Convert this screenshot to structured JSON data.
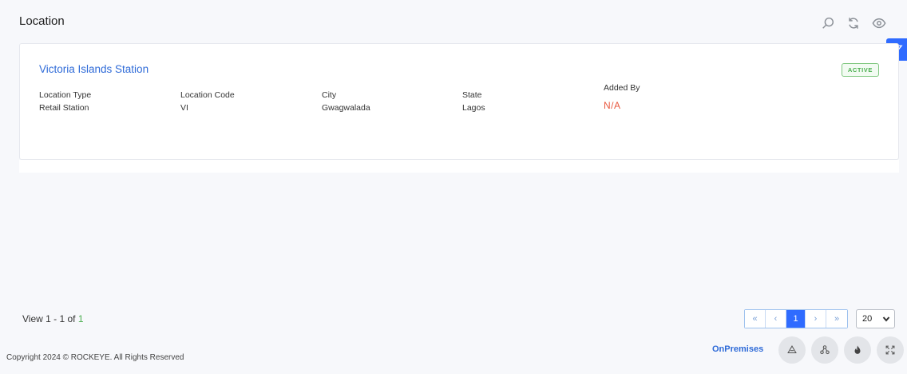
{
  "header": {
    "title": "Location",
    "icons": [
      "search-icon",
      "refresh-icon",
      "eye-icon"
    ],
    "filter_icon": "filter-icon"
  },
  "location_card": {
    "name": "Victoria Islands Station",
    "status": "ACTIVE",
    "fields": {
      "location_type": {
        "label": "Location Type",
        "value": "Retail Station"
      },
      "location_code": {
        "label": "Location Code",
        "value": "VI"
      },
      "city": {
        "label": "City",
        "value": "Gwagwalada"
      },
      "state": {
        "label": "State",
        "value": "Lagos"
      },
      "added_by": {
        "label": "Added By",
        "value": "N/A"
      }
    }
  },
  "pagination": {
    "view_prefix": "View 1 - 1 of ",
    "view_total": "1",
    "first": "«",
    "prev": "‹",
    "current": "1",
    "next": "›",
    "last": "»",
    "page_size": "20"
  },
  "footer": {
    "copyright": "Copyright 2024 © ROCKEYE. All Rights Reserved",
    "mode": "OnPremises",
    "fab_icons": [
      "recycle-icon",
      "network-icon",
      "fire-icon",
      "expand-icon"
    ]
  },
  "colors": {
    "accent": "#2f6bff",
    "link": "#2f6bd8",
    "active": "#4caf50",
    "na": "#e8593f"
  }
}
